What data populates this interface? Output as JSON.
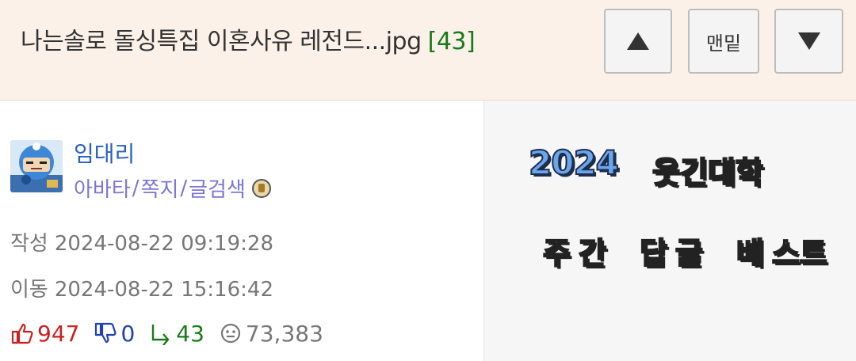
{
  "header": {
    "title": "나는솔로 돌싱특집 이혼사유 레전드...jpg",
    "comment_count": "[43]",
    "btn_bottom_label": "맨밑"
  },
  "author": {
    "name": "임대리",
    "tools": [
      "아바타",
      "쪽지",
      "글검색"
    ],
    "separator": "/"
  },
  "meta": {
    "written_label": "작성",
    "written_value": "2024-08-22 09:19:28",
    "moved_label": "이동",
    "moved_value": "2024-08-22 15:16:42"
  },
  "stats": {
    "upvotes": "947",
    "downvotes": "0",
    "replies": "43",
    "views": "73,383"
  },
  "promo": {
    "year": "2024",
    "university": "웃긴대학",
    "w1": "주",
    "w2": "간",
    "w3": "답",
    "w4": "글",
    "w5": "베",
    "w6": "스트"
  },
  "colors": {
    "header_bg": "#fbf1e8",
    "count_green": "#1a7a1a",
    "author_blue": "#2b5fbf",
    "tools_purple": "#7b76d6",
    "up_red": "#cc2020",
    "down_blue": "#2040b8"
  },
  "icons": {
    "up": "arrow-up-icon",
    "down": "arrow-down-icon",
    "thumbs_up": "thumbs-up-icon",
    "thumbs_down": "thumbs-down-icon",
    "reply": "reply-icon",
    "views": "eye-icon",
    "badge": "level-badge-icon"
  }
}
